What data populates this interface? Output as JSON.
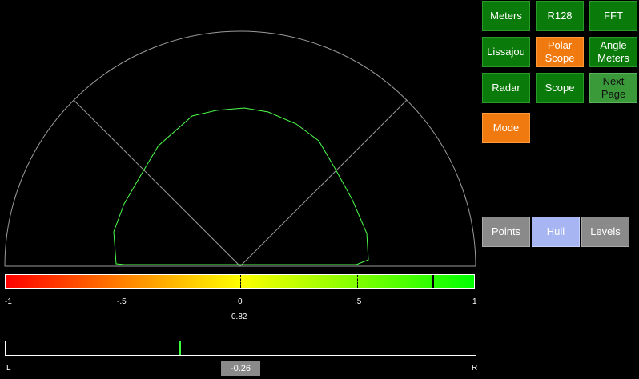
{
  "buttons": {
    "meters": "Meters",
    "r128": "R128",
    "fft": "FFT",
    "lissajou": "Lissajou",
    "polar_scope": "Polar Scope",
    "angle_meters": "Angle Meters",
    "radar": "Radar",
    "scope": "Scope",
    "next_page": "Next Page",
    "mode": "Mode",
    "points": "Points",
    "hull": "Hull",
    "levels": "Levels"
  },
  "correlation": {
    "tick_labels": [
      "-1",
      "-.5",
      "0",
      ".5",
      "1"
    ],
    "value": 0.82,
    "value_label": "0.82"
  },
  "balance": {
    "left_label": "L",
    "right_label": "R",
    "value": -0.26,
    "value_label": "-0.26"
  },
  "colors": {
    "accent_active": "#f07a10",
    "button_green": "#0a7a0a",
    "trace": "#4cff4c"
  }
}
